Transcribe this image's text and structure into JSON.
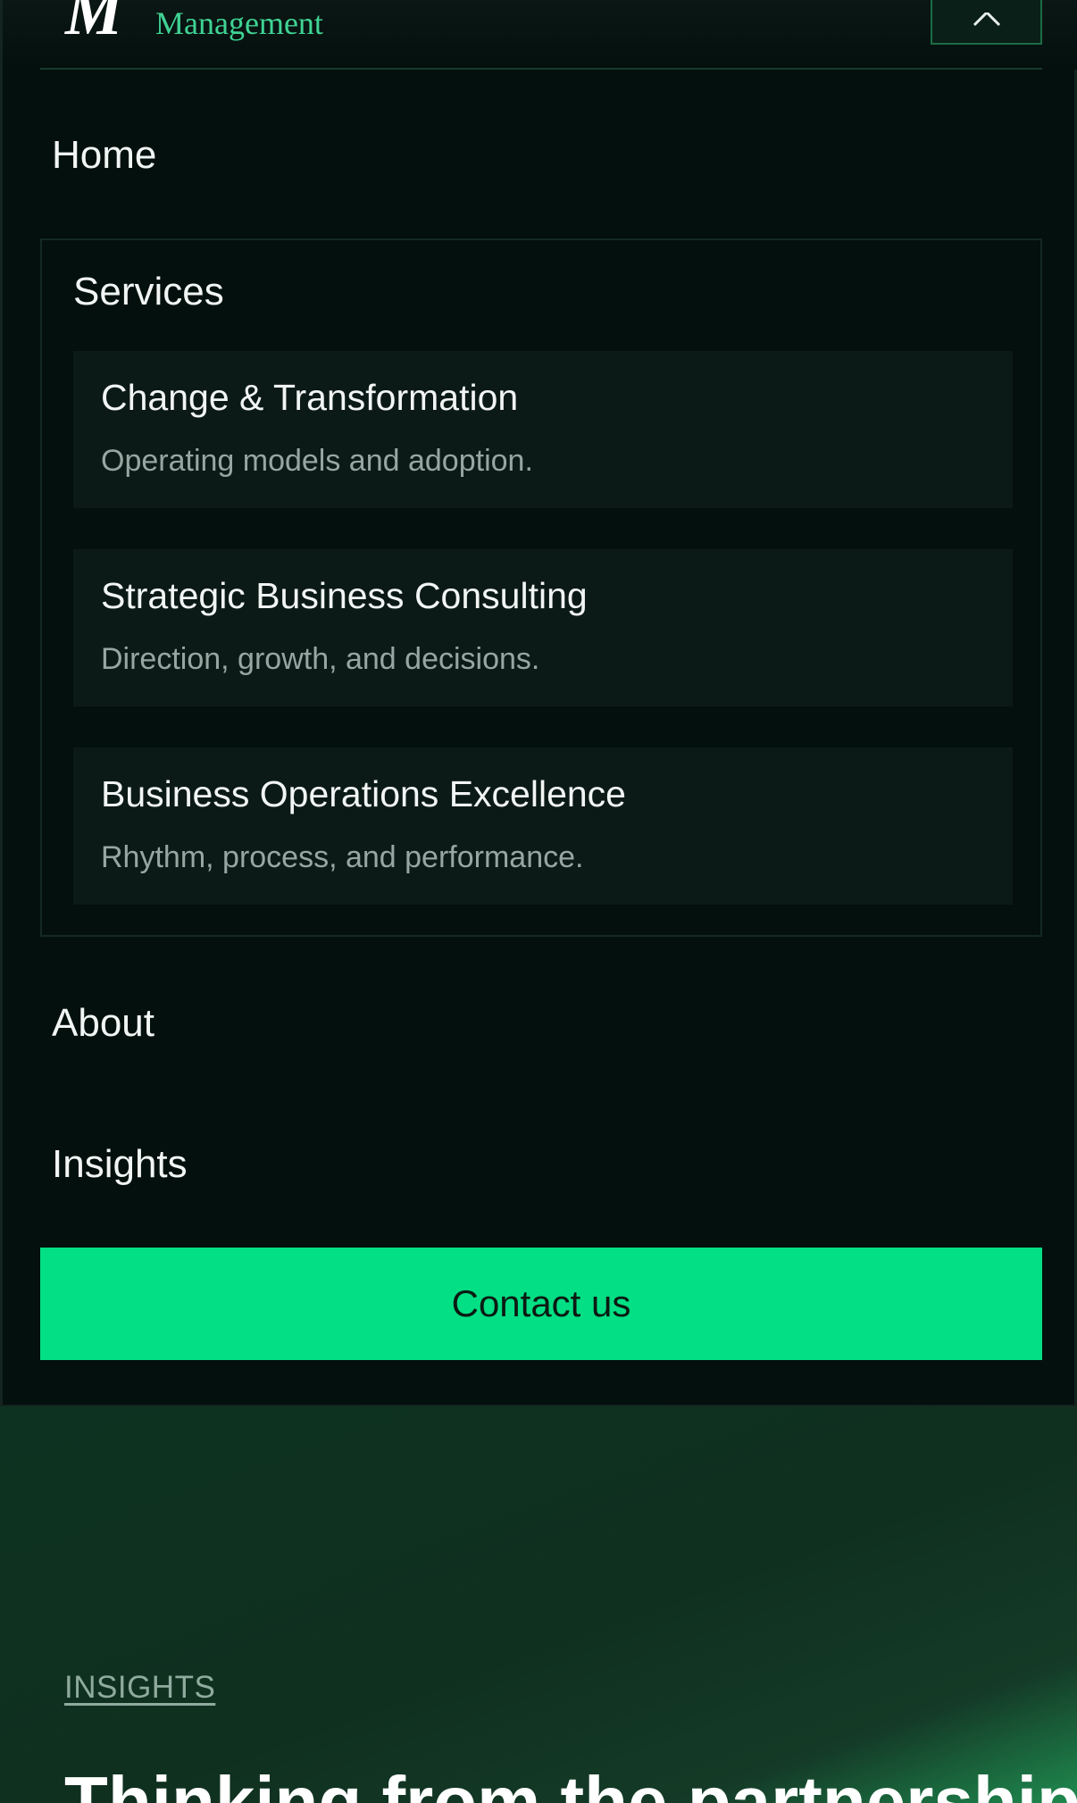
{
  "brand": {
    "logo_mark": "M",
    "name": "Management",
    "accent_color": "#3fd394"
  },
  "header": {
    "close_icon": "close-icon"
  },
  "nav": {
    "home_label": "Home",
    "services_label": "Services",
    "about_label": "About",
    "insights_label": "Insights"
  },
  "services": [
    {
      "title": "Change & Transformation",
      "description": "Operating models and adoption."
    },
    {
      "title": "Strategic Business Consulting",
      "description": "Direction, growth, and decisions."
    },
    {
      "title": "Business Operations Excellence",
      "description": "Rhythm, process, and performance."
    }
  ],
  "cta": {
    "label": "Contact us",
    "color": "#03df84"
  },
  "section": {
    "kicker": "INSIGHTS",
    "heading": "Thinking from the partnership"
  }
}
